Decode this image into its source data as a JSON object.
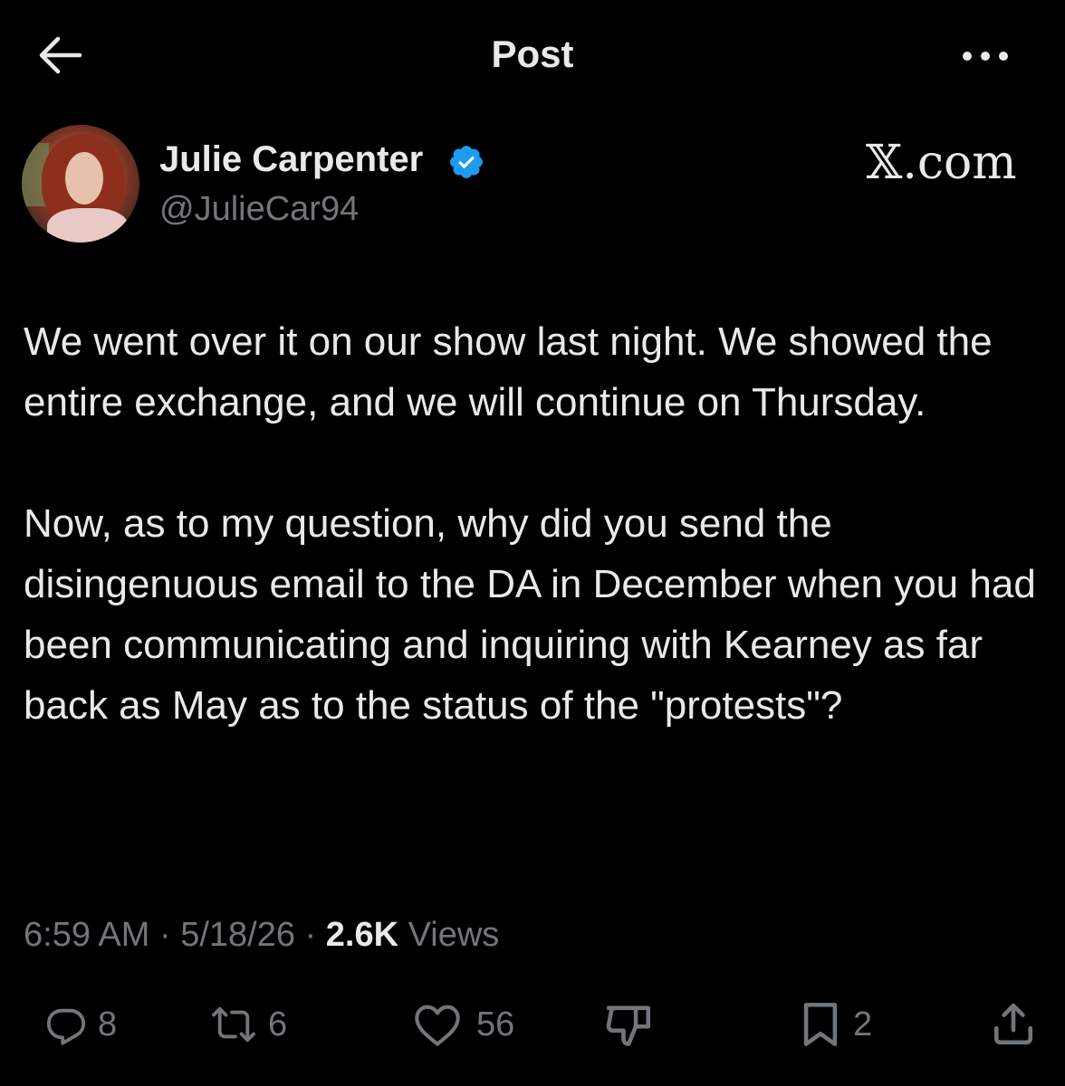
{
  "header": {
    "title": "Post"
  },
  "author": {
    "display_name": "Julie Carpenter",
    "handle": "@JulieCar94",
    "verified": true
  },
  "watermark": "𝕏.com",
  "post": {
    "paragraphs": [
      "We went over it on our show last night. We showed the entire exchange, and we will continue on Thursday.",
      "Now, as to my question, why did you send the disingenuous email to the DA in December when you had been communicating and inquiring with Kearney as far back as May as to the status of the \"protests\"?"
    ]
  },
  "meta": {
    "time": "6:59 AM",
    "separator": " · ",
    "date": "5/18/26",
    "views_count": "2.6K",
    "views_label": " Views"
  },
  "actions": {
    "replies": "8",
    "reposts": "6",
    "likes": "56",
    "bookmarks": "2"
  },
  "colors": {
    "background": "#000000",
    "text_primary": "#e7e9ea",
    "text_secondary": "#71767b",
    "verified_blue": "#1d9bf0"
  }
}
